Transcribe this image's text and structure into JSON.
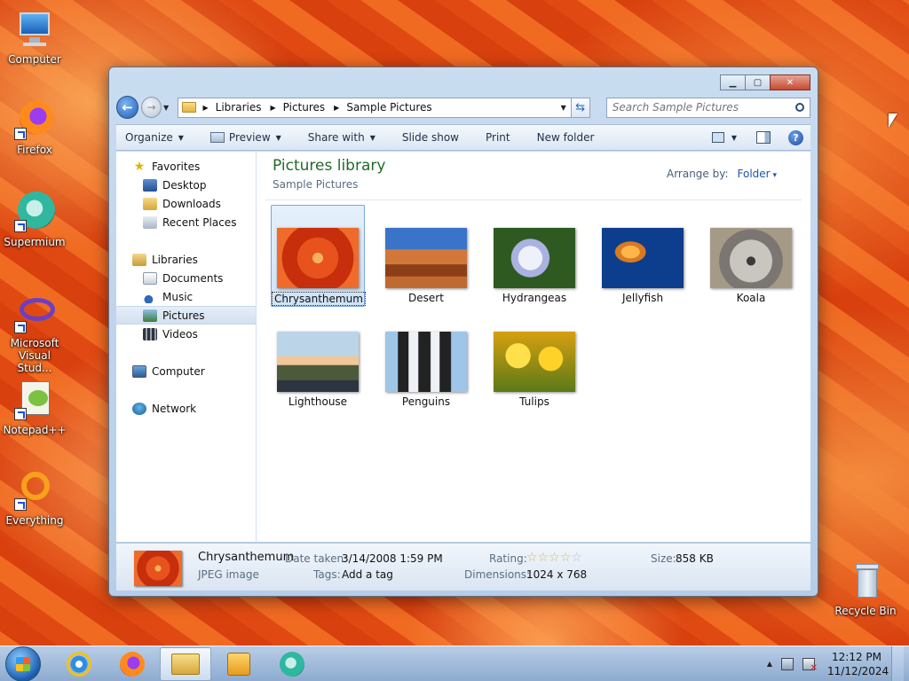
{
  "desktop": {
    "icons": [
      {
        "label": "Computer"
      },
      {
        "label": "Firefox"
      },
      {
        "label": "Supermium"
      },
      {
        "label": "Microsoft Visual Stud..."
      },
      {
        "label": "Notepad++"
      },
      {
        "label": "Everything"
      },
      {
        "label": "Recycle Bin"
      }
    ]
  },
  "window": {
    "address": {
      "crumbs": [
        "Libraries",
        "Pictures",
        "Sample Pictures"
      ]
    },
    "search": {
      "placeholder": "Search Sample Pictures"
    },
    "toolbar": {
      "organize": "Organize",
      "preview": "Preview",
      "share_with": "Share with",
      "slide_show": "Slide show",
      "print": "Print",
      "new_folder": "New folder"
    },
    "nav": {
      "favorites": "Favorites",
      "desktop": "Desktop",
      "downloads": "Downloads",
      "recent_places": "Recent Places",
      "libraries": "Libraries",
      "documents": "Documents",
      "music": "Music",
      "pictures": "Pictures",
      "videos": "Videos",
      "computer": "Computer",
      "network": "Network"
    },
    "content": {
      "title": "Pictures library",
      "subtitle": "Sample Pictures",
      "arrange_label": "Arrange by:",
      "arrange_value": "Folder",
      "items": [
        {
          "name": "Chrysanthemum"
        },
        {
          "name": "Desert"
        },
        {
          "name": "Hydrangeas"
        },
        {
          "name": "Jellyfish"
        },
        {
          "name": "Koala"
        },
        {
          "name": "Lighthouse"
        },
        {
          "name": "Penguins"
        },
        {
          "name": "Tulips"
        }
      ]
    },
    "details": {
      "name": "Chrysanthemum",
      "type": "JPEG image",
      "date_taken_label": "Date taken:",
      "date_taken": "3/14/2008 1:59 PM",
      "tags_label": "Tags:",
      "tags": "Add a tag",
      "rating_label": "Rating:",
      "dimensions_label": "Dimensions:",
      "dimensions": "1024 x 768",
      "size_label": "Size:",
      "size": "858 KB"
    }
  },
  "taskbar": {
    "time": "12:12 PM",
    "date": "11/12/2024"
  }
}
